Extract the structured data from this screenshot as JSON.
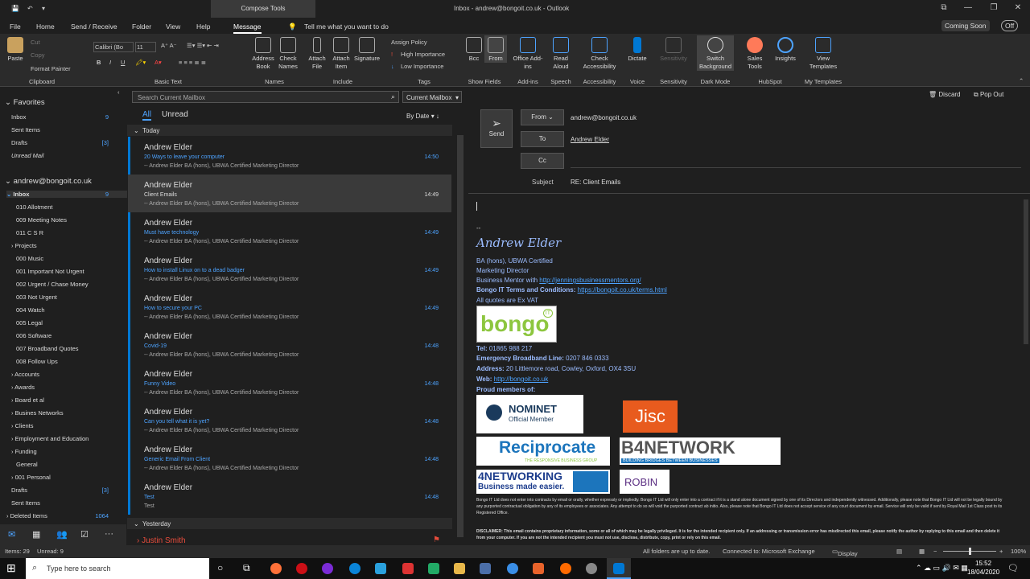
{
  "titlebar": {
    "context_tab": "Compose Tools",
    "title": "Inbox - andrew@bongoit.co.uk - Outlook"
  },
  "menubar": {
    "items": [
      "File",
      "Home",
      "Send / Receive",
      "Folder",
      "View",
      "Help",
      "Message"
    ],
    "tellme": "Tell me what you want to do",
    "coming_soon": "Coming Soon",
    "toggle": "Off"
  },
  "ribbon": {
    "clipboard": {
      "paste": "Paste",
      "cut": "Cut",
      "copy": "Copy",
      "format_painter": "Format Painter",
      "label": "Clipboard"
    },
    "basic_text": {
      "font": "Calibri (Bo",
      "size": "11",
      "label": "Basic Text"
    },
    "names": {
      "address_book": "Address Book",
      "check_names": "Check Names",
      "label": "Names"
    },
    "include": {
      "attach_file": "Attach File",
      "attach_item": "Attach Item",
      "signature": "Signature",
      "label": "Include"
    },
    "tags": {
      "assign_policy": "Assign Policy",
      "high": "High Importance",
      "low": "Low Importance",
      "label": "Tags"
    },
    "show_fields": {
      "bcc": "Bcc",
      "from": "From",
      "label": "Show Fields"
    },
    "addins": {
      "office": "Office Add-ins",
      "label": "Add-ins"
    },
    "speech": {
      "read_aloud": "Read Aloud",
      "label": "Speech"
    },
    "accessibility": {
      "check": "Check Accessibility",
      "label": "Accessibility"
    },
    "voice": {
      "dictate": "Dictate",
      "label": "Voice"
    },
    "sensitivity": {
      "btn": "Sensitivity",
      "label": "Sensitivity"
    },
    "darkmode": {
      "switch": "Switch Background",
      "label": "Dark Mode"
    },
    "hubspot": {
      "sales": "Sales Tools",
      "insights": "Insights",
      "label": "HubSpot"
    },
    "templates": {
      "view": "View Templates",
      "label": "My Templates"
    }
  },
  "sidebar": {
    "favorites_label": "Favorites",
    "favorites": [
      {
        "label": "Inbox",
        "count": "9"
      },
      {
        "label": "Sent Items",
        "count": ""
      },
      {
        "label": "Drafts",
        "count": "[3]"
      },
      {
        "label": "Unread Mail",
        "count": ""
      }
    ],
    "account": "andrew@bongoit.co.uk",
    "inbox": {
      "label": "Inbox",
      "count": "9"
    },
    "folders": [
      {
        "label": "010 Allotment"
      },
      {
        "label": "009 Meeting Notes"
      },
      {
        "label": "011 C S R"
      },
      {
        "label": "Projects"
      },
      {
        "label": "000 Music"
      },
      {
        "label": "001 Important Not Urgent"
      },
      {
        "label": "002 Urgent / Chase Money"
      },
      {
        "label": "003 Not Urgent"
      },
      {
        "label": "004 Watch"
      },
      {
        "label": "005 Legal"
      },
      {
        "label": "006 Software"
      },
      {
        "label": "007 Broadband Quotes"
      },
      {
        "label": "008 Follow Ups"
      },
      {
        "label": "Accounts"
      },
      {
        "label": "Awards"
      },
      {
        "label": "Board et al"
      },
      {
        "label": "Busines Networks"
      },
      {
        "label": "Clients"
      },
      {
        "label": "Employment and Education"
      },
      {
        "label": "Funding"
      },
      {
        "label": "General"
      },
      {
        "label": "001 Personal"
      }
    ],
    "bottom": [
      {
        "label": "Drafts",
        "count": "[3]"
      },
      {
        "label": "Sent Items",
        "count": ""
      },
      {
        "label": "Deleted Items",
        "count": "1064"
      }
    ]
  },
  "msglist": {
    "search_placeholder": "Search Current Mailbox",
    "scope": "Current Mailbox",
    "tab_all": "All",
    "tab_unread": "Unread",
    "sort": "By Date",
    "group_today": "Today",
    "group_yesterday": "Yesterday",
    "messages": [
      {
        "from": "Andrew Elder",
        "subject": "20 Ways to leave your computer",
        "preview": "-- Andrew Elder   BA (hons), UBWA Certified  Marketing Director",
        "time": "14:50"
      },
      {
        "from": "Andrew Elder",
        "subject": "Client Emails",
        "preview": "-- Andrew Elder   BA (hons), UBWA Certified  Marketing Director",
        "time": "14:49"
      },
      {
        "from": "Andrew Elder",
        "subject": "Must have technology",
        "preview": "-- Andrew Elder   BA (hons), UBWA Certified  Marketing Director",
        "time": "14:49"
      },
      {
        "from": "Andrew Elder",
        "subject": "How to install Linux on to a dead badger",
        "preview": "-- Andrew Elder   BA (hons), UBWA Certified  Marketing Director",
        "time": "14:49"
      },
      {
        "from": "Andrew Elder",
        "subject": "How to secure your PC",
        "preview": "-- Andrew Elder   BA (hons), UBWA Certified  Marketing Director",
        "time": "14:49"
      },
      {
        "from": "Andrew Elder",
        "subject": "Covid-19",
        "preview": "-- Andrew Elder   BA (hons), UBWA Certified  Marketing Director",
        "time": "14:48"
      },
      {
        "from": "Andrew Elder",
        "subject": "Funny Video",
        "preview": "-- Andrew Elder   BA (hons), UBWA Certified  Marketing Director",
        "time": "14:48"
      },
      {
        "from": "Andrew Elder",
        "subject": "Can you tell what it is yet?",
        "preview": "-- Andrew Elder   BA (hons), UBWA Certified  Marketing Director",
        "time": "14:48"
      },
      {
        "from": "Andrew Elder",
        "subject": "Generic Email From Client",
        "preview": "-- Andrew Elder   BA (hons), UBWA Certified  Marketing Director",
        "time": "14:48"
      },
      {
        "from": "Andrew Elder",
        "subject": "Test",
        "preview": "Test",
        "time": "14:48"
      }
    ],
    "yesterday_item": "Justin Smith"
  },
  "compose": {
    "discard": "Discard",
    "popout": "Pop Out",
    "send": "Send",
    "from_btn": "From",
    "from_value": "andrew@bongoit.co.uk",
    "to_btn": "To",
    "to_value": "Andrew Elder",
    "cc_btn": "Cc",
    "subject_label": "Subject",
    "subject_value": "RE: Client Emails",
    "sig": {
      "dash": "--",
      "name": "Andrew Elder",
      "line1": "BA (hons), UBWA Certified",
      "line2": "Marketing Director",
      "mentor_label": "Business Mentor with ",
      "mentor_link": "http://jenningsbusinessmentors.org/",
      "terms_label": "Bongo IT Terms and Conditions: ",
      "terms_link": "https://bongoit.co.uk/terms.html",
      "quotes": "All quotes are Ex VAT",
      "logo": "bongo",
      "logo_badge": "IT",
      "tel_label": "Tel: ",
      "tel": "01865 988 217",
      "emergency_label": "Emergency Broadband Line: ",
      "emergency": "0207 846 0333",
      "address_label": "Address: ",
      "address": "20 Littlemore road, Cowley, Oxford, OX4 3SU",
      "web_label": "Web: ",
      "web": "http://bongoit.co.uk",
      "proud": "Proud members of:",
      "nominet": "NOMINET",
      "nominet_sub": "Official Member",
      "jisc": "Jisc",
      "reciprocate": "Reciprocate",
      "reciprocate_sub": "THE RESPONSIVE BUSINESS GROUP",
      "b4": "B4NETWORK",
      "b4_sub": "BUILDING BRIDGES BETWEEN BUSINESSES",
      "fournet": "4NETWORKING",
      "fournet_sub": "Business made easier.",
      "robin": "ROBIN",
      "disclaimer1": "Bongo IT Ltd does not enter into contracts by email or orally, whether expressly or impliedly.  Bongo IT Ltd will only enter into a contract if it is a stand alone document signed by one of its Directors and independently witnessed.  Additionally, please note that Bongo IT Ltd will not be legally bound by any purported contractual obligation by any of its employees or associates.  Any attempt to do so will void the purported contract ab initio. Also, please note that Bongo IT Ltd does not accept service of any court document by email. Service will only be valid if sent by Royal Mail 1st Class post to its  Registered Office.",
      "disclaimer2": "DISCLAIMER: This email contains proprietary information, some or all of which may be legally privileged. It is for the intended recipient only. If an addressing or transmission error has misdirected this email, please notify the author by replying to this email and then delete it from your computer. If you are not the intended recipient you must not use, disclose, distribute, copy, print or rely on this email."
    }
  },
  "statusbar": {
    "items": "Items: 29",
    "unread": "Unread: 9",
    "uptodate": "All folders are up to date.",
    "connected": "Connected to: Microsoft Exchange",
    "display": "Display Settings",
    "zoom": "100%"
  },
  "taskbar": {
    "search": "Type here to search",
    "time": "15:52",
    "date": "18/04/2020"
  },
  "colors": {
    "accent": "#0078d4",
    "link": "#4da3ff",
    "sig": "#9bbcff",
    "flag": "#e74c3c"
  }
}
